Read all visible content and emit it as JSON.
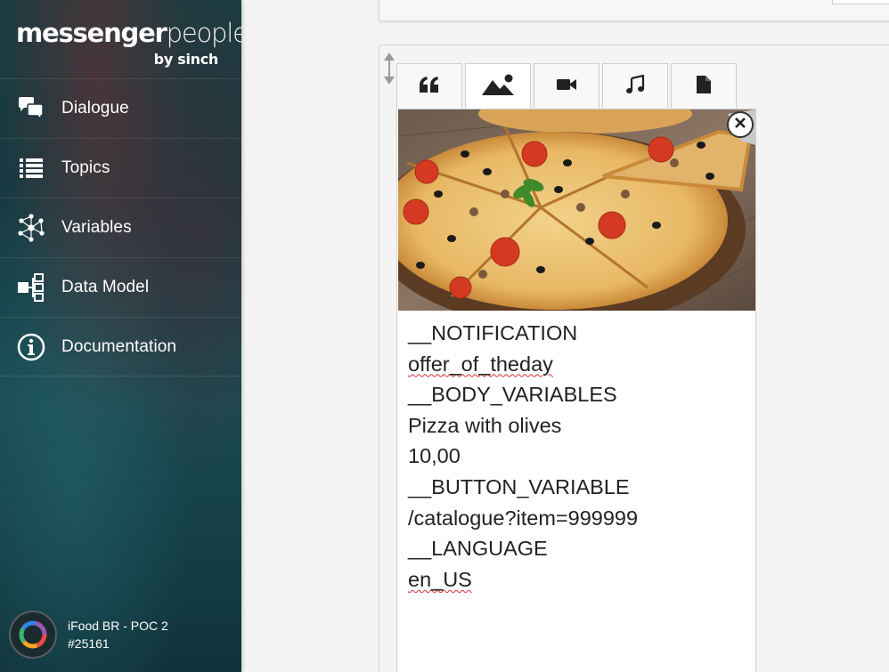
{
  "brand": {
    "logo_bold": "messenger",
    "logo_light": "people",
    "logo_sub": "by sinch"
  },
  "sidebar": {
    "items": [
      {
        "label": "Dialogue",
        "icon": "chat-bubbles-icon"
      },
      {
        "label": "Topics",
        "icon": "list-icon"
      },
      {
        "label": "Variables",
        "icon": "network-icon"
      },
      {
        "label": "Data Model",
        "icon": "hierarchy-icon"
      },
      {
        "label": "Documentation",
        "icon": "info-icon"
      }
    ],
    "account": {
      "name": "iFood BR - POC 2",
      "id": "#25161"
    }
  },
  "editor": {
    "tabs": [
      {
        "name": "quote-icon"
      },
      {
        "name": "image-icon",
        "active": true
      },
      {
        "name": "video-icon"
      },
      {
        "name": "music-icon"
      },
      {
        "name": "document-icon"
      }
    ],
    "card": {
      "image_alt": "pizza-image",
      "lines": [
        "__NOTIFICATION",
        "offer_of_theday",
        "__BODY_VARIABLES",
        "Pizza with olives",
        "10,00",
        "__BUTTON_VARIABLE",
        "/catalogue?item=999999",
        "__LANGUAGE",
        "en_US"
      ]
    }
  },
  "colors": {
    "sidebar_dark": "#183a42",
    "text": "#222222",
    "spellcheck": "#d93030"
  }
}
